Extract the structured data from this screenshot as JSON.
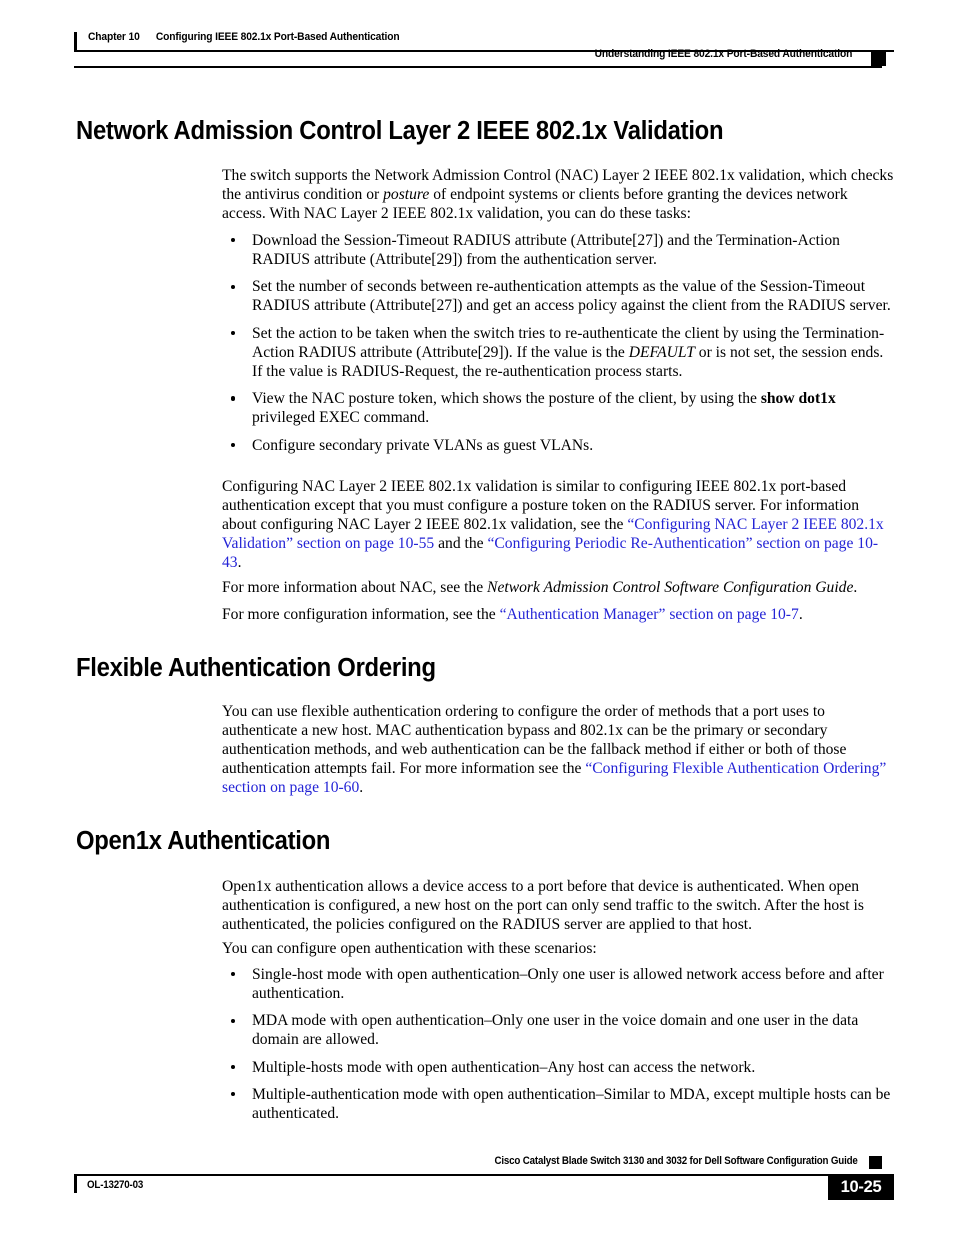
{
  "header": {
    "chapter_label": "Chapter 10",
    "chapter_title": "Configuring IEEE 802.1x Port-Based Authentication",
    "running_head": "Understanding IEEE 802.1x Port-Based Authentication"
  },
  "sections": {
    "nac": {
      "heading": "Network Admission Control Layer 2 IEEE 802.1x Validation",
      "intro_1": "The switch supports the Network Admission Control (NAC) Layer 2 IEEE 802.1x validation, which checks the antivirus condition or ",
      "intro_italic": "posture",
      "intro_2": " of endpoint systems or clients before granting the devices network access. With NAC Layer 2 IEEE 802.1x validation, you can do these tasks:",
      "bullets": [
        {
          "parts": [
            {
              "text": "Download the Session-Timeout RADIUS attribute (Attribute[27]) and the Termination-Action RADIUS attribute (Attribute[29]) from the authentication server.",
              "style": "normal"
            }
          ]
        },
        {
          "parts": [
            {
              "text": "Set the number of seconds between re-authentication attempts as the value of the Session-Timeout RADIUS attribute (Attribute[27]) and get an access policy against the client from the RADIUS server.",
              "style": "normal"
            }
          ]
        },
        {
          "parts": [
            {
              "text": "Set the action to be taken when the switch tries to re-authenticate the client by using the Termination-Action RADIUS attribute (Attribute[29]). If the value is the ",
              "style": "normal"
            },
            {
              "text": "DEFAULT",
              "style": "italic"
            },
            {
              "text": " or is not set, the session ends. If the value is RADIUS-Request, the re-authentication process starts.",
              "style": "normal"
            }
          ]
        },
        {
          "parts": [
            {
              "text": "View the NAC posture token, which shows the posture of the client, by using the ",
              "style": "normal"
            },
            {
              "text": "show dot1x",
              "style": "bold"
            },
            {
              "text": " privileged EXEC command.",
              "style": "normal"
            }
          ]
        },
        {
          "parts": [
            {
              "text": "Configure secondary private VLANs as guest VLANs.",
              "style": "normal"
            }
          ]
        }
      ],
      "xref_para": [
        {
          "text": "Configuring NAC Layer 2 IEEE 802.1x validation is similar to configuring IEEE 802.1x port-based authentication except that you must configure a posture token on the RADIUS server. For information about configuring NAC Layer 2 IEEE 802.1x validation, see the ",
          "style": "normal"
        },
        {
          "text": "“Configuring NAC Layer 2 IEEE 802.1x Validation” section on page 10-55",
          "style": "link"
        },
        {
          "text": " and the ",
          "style": "normal"
        },
        {
          "text": "“Configuring Periodic Re-Authentication” section on page 10-43",
          "style": "link"
        },
        {
          "text": ".",
          "style": "normal"
        }
      ],
      "nac_guide_para": [
        {
          "text": "For more information about NAC, see the ",
          "style": "normal"
        },
        {
          "text": "Network Admission Control Software Configuration Guide",
          "style": "italic"
        },
        {
          "text": ".",
          "style": "normal"
        }
      ],
      "auth_mgr_para": [
        {
          "text": "For more configuration information, see the ",
          "style": "normal"
        },
        {
          "text": "“Authentication Manager” section on page 10-7",
          "style": "link"
        },
        {
          "text": ".",
          "style": "normal"
        }
      ]
    },
    "flexible": {
      "heading": "Flexible Authentication Ordering",
      "para": [
        {
          "text": "You can use flexible authentication ordering to configure the order of methods that a port uses to authenticate a new host. MAC authentication bypass and 802.1x can be the primary or secondary authentication methods, and web authentication can be the fallback method if either or both of those authentication attempts fail. For more information see the ",
          "style": "normal"
        },
        {
          "text": "“Configuring Flexible Authentication Ordering” section on page 10-60",
          "style": "link"
        },
        {
          "text": ".",
          "style": "normal"
        }
      ]
    },
    "open1x": {
      "heading": "Open1x Authentication",
      "para_1": "Open1x authentication allows a device access to a port before that device is authenticated. When open authentication is configured, a new host on the port can only send traffic to the switch. After the host is authenticated, the policies configured on the RADIUS server are applied to that host.",
      "para_2": "You can configure open authentication with these scenarios:",
      "bullets": [
        {
          "parts": [
            {
              "text": "Single-host mode with open authentication–Only one user is allowed network access before and after authentication.",
              "style": "normal"
            }
          ]
        },
        {
          "parts": [
            {
              "text": "MDA mode with open authentication–Only one user in the voice domain and one user in the data domain are allowed.",
              "style": "normal"
            }
          ]
        },
        {
          "parts": [
            {
              "text": "Multiple-hosts mode with open authentication–Any host can access the network.",
              "style": "normal"
            }
          ]
        },
        {
          "parts": [
            {
              "text": "Multiple-authentication mode with open authentication–Similar to MDA, except multiple hosts can be authenticated.",
              "style": "normal"
            }
          ]
        }
      ]
    }
  },
  "footer": {
    "guide_title": "Cisco Catalyst Blade Switch 3130 and 3032 for Dell Software Configuration Guide",
    "doc_id": "OL-13270-03",
    "page_number": "10-25"
  },
  "colors": {
    "link": "#2424d6",
    "text": "#000000",
    "rule": "#000000"
  }
}
